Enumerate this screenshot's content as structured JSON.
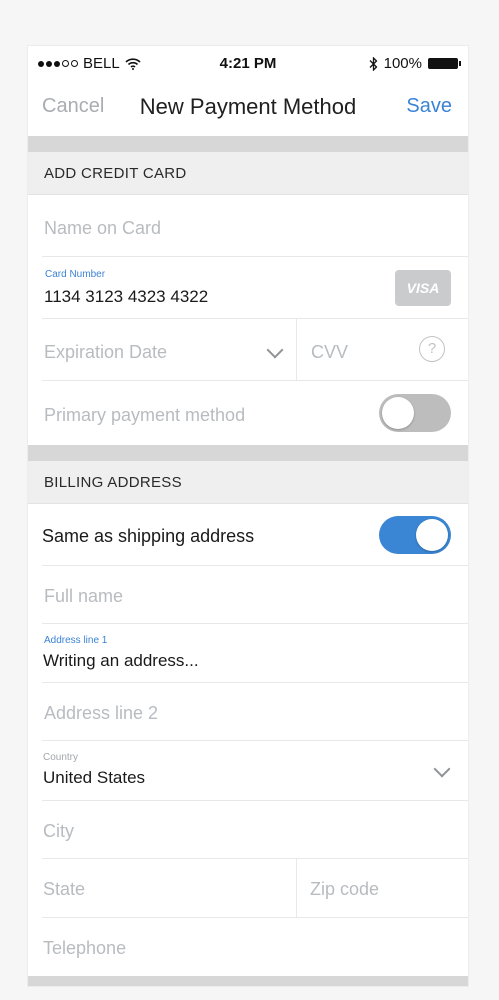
{
  "status_bar": {
    "carrier": "BELL",
    "time": "4:21 PM",
    "battery": "100%"
  },
  "nav": {
    "cancel": "Cancel",
    "title": "New Payment Method",
    "save": "Save"
  },
  "credit_card": {
    "header": "ADD CREDIT CARD",
    "name_placeholder": "Name on Card",
    "card_number_label": "Card Number",
    "card_number_value": "1134 3123 4323 4322",
    "card_brand": "VISA",
    "expiration_placeholder": "Expiration Date",
    "cvv_placeholder": "CVV",
    "cvv_help": "?",
    "primary_label": "Primary payment method",
    "primary_toggle": false
  },
  "billing": {
    "header": "BILLING ADDRESS",
    "same_as_shipping_label": "Same as shipping address",
    "same_as_shipping_toggle": true,
    "full_name_placeholder": "Full name",
    "address1_label": "Address line 1",
    "address1_value": "Writing an address...",
    "address2_placeholder": "Address line 2",
    "country_label": "Country",
    "country_value": "United States",
    "city_placeholder": "City",
    "state_placeholder": "State",
    "zip_placeholder": "Zip code",
    "telephone_placeholder": "Telephone"
  },
  "colors": {
    "accent": "#3b83d5",
    "toggle_on": "#3a86d4",
    "toggle_off": "#bdbdbd"
  }
}
